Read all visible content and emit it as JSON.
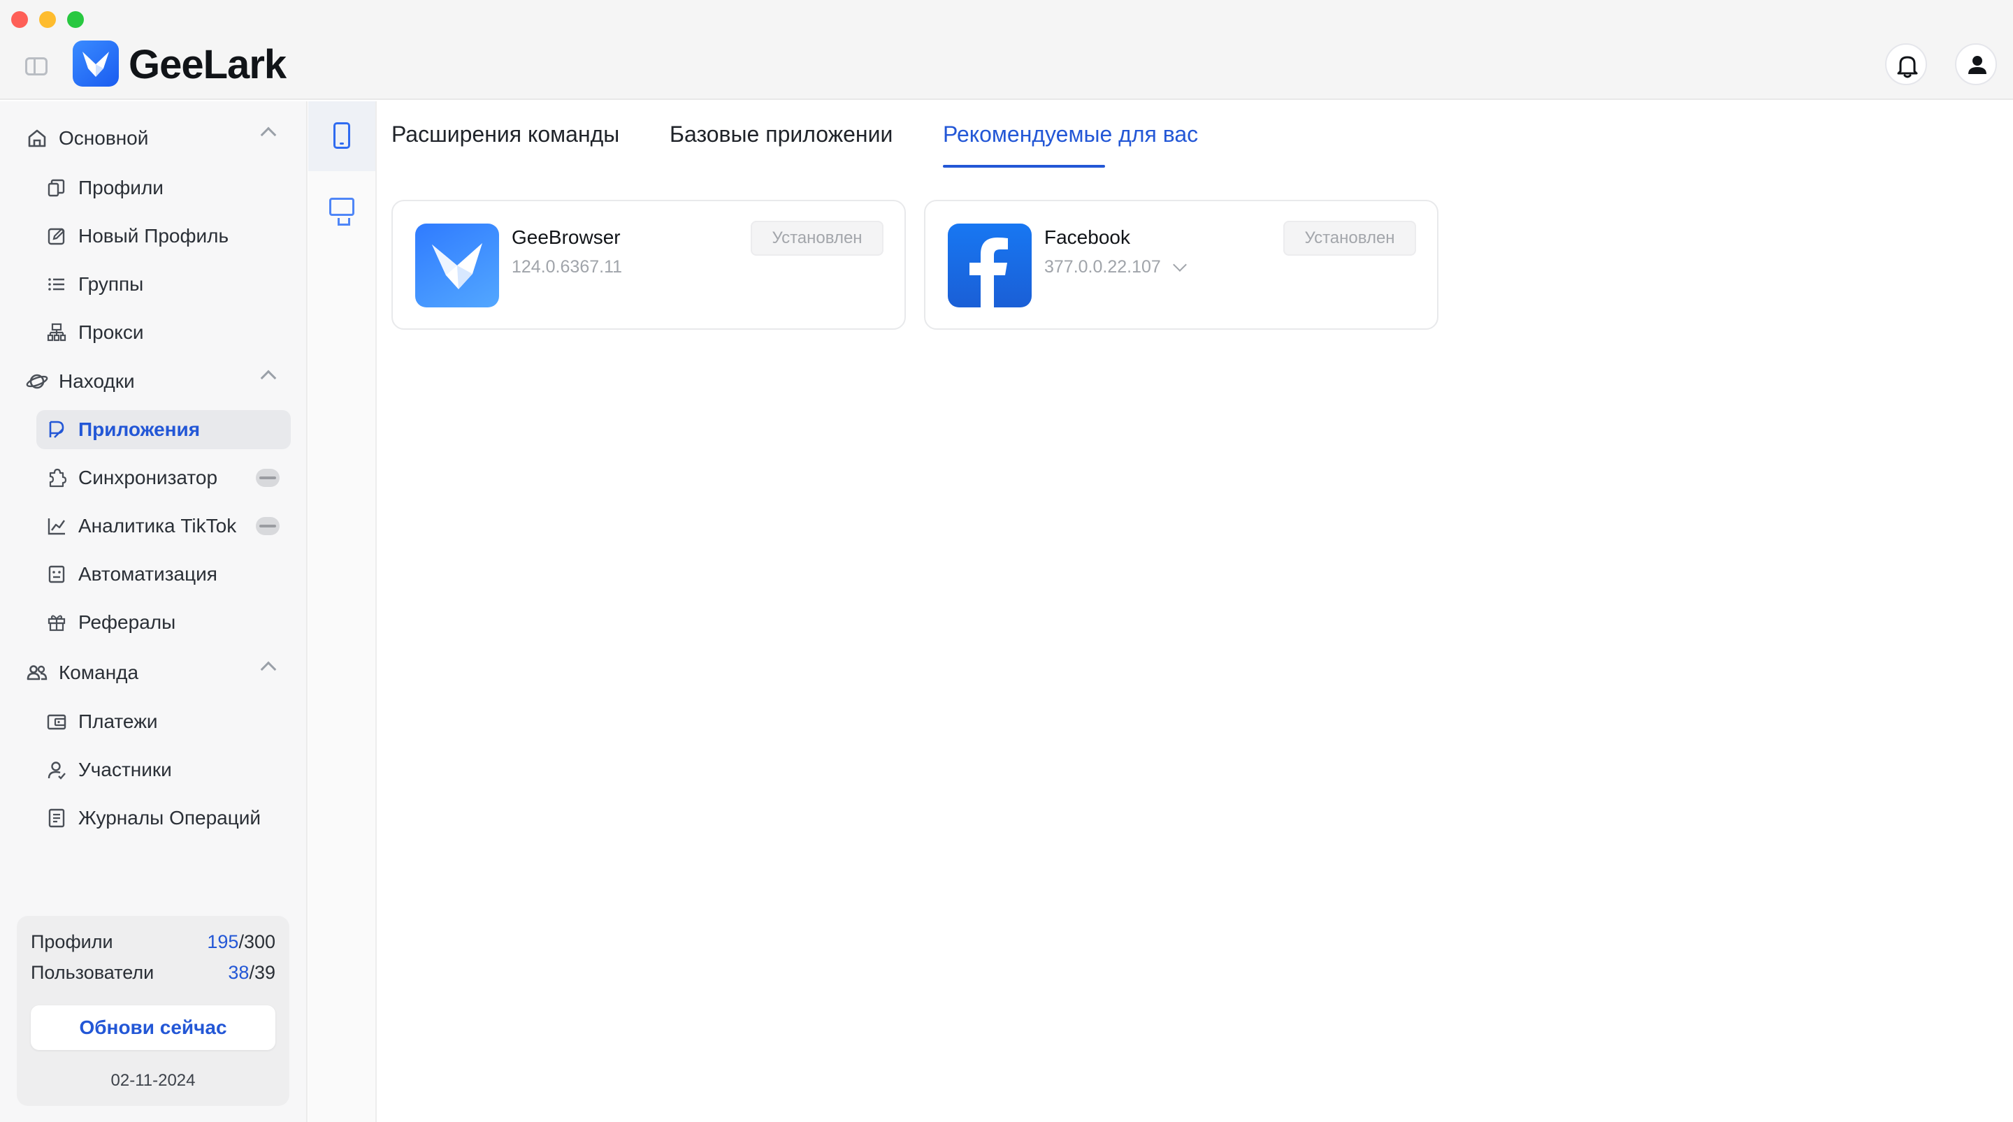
{
  "app": {
    "name": "GeeLark"
  },
  "sidebar": {
    "sections": [
      {
        "label": "Основной"
      },
      {
        "label": "Находки"
      },
      {
        "label": "Команда"
      }
    ],
    "items": [
      {
        "label": "Профили"
      },
      {
        "label": "Новый Профиль"
      },
      {
        "label": "Группы"
      },
      {
        "label": "Прокси"
      },
      {
        "label": "Приложения"
      },
      {
        "label": "Синхронизатор"
      },
      {
        "label": "Аналитика TikTok"
      },
      {
        "label": "Автоматизация"
      },
      {
        "label": "Рефералы"
      },
      {
        "label": "Платежи"
      },
      {
        "label": "Участники"
      },
      {
        "label": "Журналы Операций"
      }
    ],
    "active_item": "Приложения"
  },
  "plan": {
    "profiles_label": "Профили",
    "profiles_used": "195",
    "profiles_total": "/300",
    "users_label": "Пользователи",
    "users_used": "38",
    "users_total": "/39",
    "upgrade_label": "Обнови сейчас",
    "date": "02-11-2024"
  },
  "tabs": [
    {
      "label": "Расширения команды"
    },
    {
      "label": "Базовые приложении"
    },
    {
      "label": "Рекомендуемые для вас"
    }
  ],
  "active_tab": "Рекомендуемые для вас",
  "apps": [
    {
      "name": "GeeBrowser",
      "version": "124.0.6367.11",
      "status": "Установлен",
      "icon": "geebrowser-icon"
    },
    {
      "name": "Facebook",
      "version": "377.0.0.22.107",
      "status": "Установлен",
      "icon": "facebook-icon"
    }
  ],
  "colors": {
    "accent": "#2357d6",
    "brand": "#2f6bf0",
    "sidebar_bg": "#f7f7f8"
  }
}
